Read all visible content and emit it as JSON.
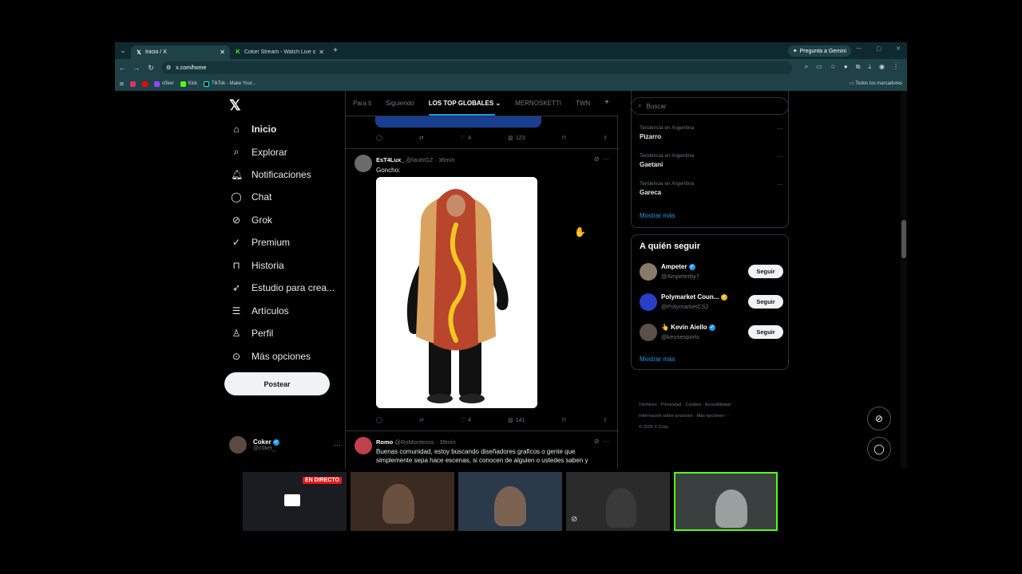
{
  "browser": {
    "tabs": [
      {
        "title": "Inicio / X",
        "favicon": "x-icon",
        "active": true
      },
      {
        "title": "Coker Stream - Watch Live on Kick",
        "favicon": "kick-icon",
        "active": false
      }
    ],
    "gemini_label": "Pregunta a Gemini",
    "url": "x.com/home",
    "bookmarks": [
      {
        "label": "",
        "color": "#e1306c"
      },
      {
        "label": "",
        "color": "#ff0000"
      },
      {
        "label": "c0ker",
        "color": "#9146ff"
      },
      {
        "label": "Kick",
        "color": "#53fc18"
      },
      {
        "label": "TikTok - Make Your...",
        "color": "#111111"
      }
    ],
    "all_bookmarks": "Todos los marcadores"
  },
  "nav": {
    "items": [
      {
        "label": "Inicio",
        "icon": "home-icon"
      },
      {
        "label": "Explorar",
        "icon": "search-icon"
      },
      {
        "label": "Notificaciones",
        "icon": "bell-icon"
      },
      {
        "label": "Chat",
        "icon": "chat-icon"
      },
      {
        "label": "Grok",
        "icon": "grok-icon"
      },
      {
        "label": "Premium",
        "icon": "premium-icon"
      },
      {
        "label": "Historia",
        "icon": "bookmark-icon"
      },
      {
        "label": "Estudio para crea...",
        "icon": "rocket-icon"
      },
      {
        "label": "Artículos",
        "icon": "article-icon"
      },
      {
        "label": "Perfil",
        "icon": "person-icon"
      },
      {
        "label": "Más opciones",
        "icon": "more-icon"
      }
    ],
    "post_button": "Postear",
    "user": {
      "name": "Coker",
      "handle": "@c0ker_"
    }
  },
  "feed": {
    "tabs": [
      "Para ti",
      "Siguiendo",
      "LOS TOP GLOBALES",
      "MERNOSKETTI",
      "TWN"
    ],
    "active_tab": "LOS TOP GLOBALES",
    "prev_actions": {
      "likes": "4",
      "views": "123"
    },
    "tweets": [
      {
        "name": "EsT4Lux_",
        "handle": "@lautiIGZ",
        "time": "· 36min",
        "text": "Goncho:",
        "likes": "4",
        "views": "141",
        "avatar_color": "#6b6b6b"
      },
      {
        "name": "Romo",
        "handle": "@RoMontesss",
        "time": "· 39min",
        "text": "Buenas comunidad, estoy buscando diseñadores graficos o gente que simplemente sepa hace escenas, si conocen de alguien o ustedes saben y",
        "avatar_color": "#c0404f"
      }
    ]
  },
  "sidebar": {
    "search_placeholder": "Buscar",
    "trends": [
      {
        "meta": "Tendencia en Argentina",
        "name": "Pizarro"
      },
      {
        "meta": "Tendencia en Argentina",
        "name": "Gaetani"
      },
      {
        "meta": "Tendencia en Argentina",
        "name": "Gareca"
      }
    ],
    "show_more": "Mostrar más",
    "who_to_follow_title": "A quién seguir",
    "follow": [
      {
        "name": "Ampeter",
        "handle": "@Ampeterby7",
        "badge": "blue",
        "avatar_color": "#8a7a6a"
      },
      {
        "name": "Polymarket Coun...",
        "handle": "@PolymarketCS2",
        "badge": "gold",
        "avatar_color": "#2a3ec8"
      },
      {
        "name": "👆 Kevin Aiello",
        "handle": "@kevoesports",
        "badge": "blue",
        "avatar_color": "#5a5048"
      }
    ],
    "follow_button": "Seguir",
    "footer_line1": "Términos · Privacidad · Cookies · Accesibilidad ·",
    "footer_line2": "Información sobre anuncios · Más opciones ···",
    "footer_line3": "© 2026 X Corp."
  },
  "streams": {
    "live_badge": "EN DIRECTO",
    "thumbs": [
      "#1b1b22",
      "#3a2a20",
      "#2a3a4a",
      "#2b2b2b",
      "#3a4040"
    ]
  }
}
